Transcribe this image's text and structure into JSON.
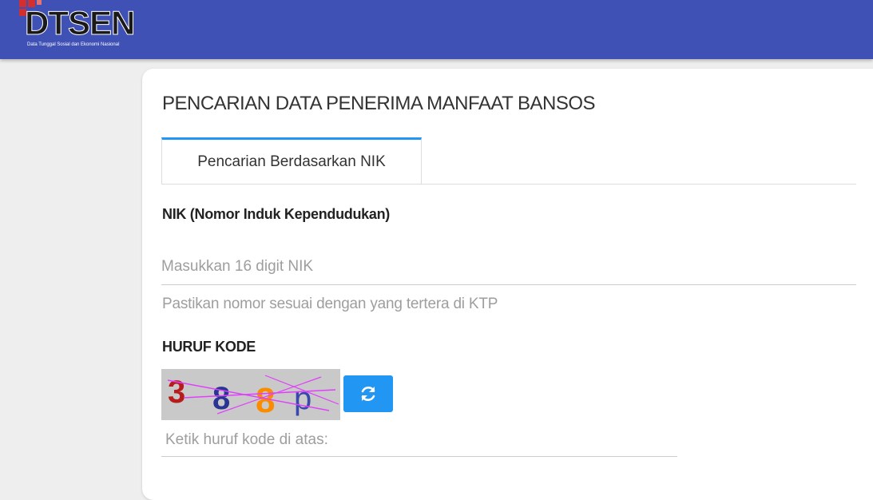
{
  "header": {
    "logo_text": "DTSEN",
    "logo_tagline": "Data Tunggal Sosial dan Ekonomi Nasional",
    "color": "#3f51b5"
  },
  "form": {
    "title": "PENCARIAN DATA PENERIMA MANFAAT BANSOS",
    "tab_label": "Pencarian Berdasarkan NIK",
    "nik_label": "NIK (Nomor Induk Kependudukan)",
    "nik_placeholder": "Masukkan 16 digit NIK",
    "nik_help": "Pastikan nomor sesuai dengan yang tertera di KTP",
    "kode_label": "HURUF KODE",
    "captcha_chars": [
      "3",
      "8",
      "8",
      "p"
    ],
    "captcha_colors": [
      "#b71c1c",
      "#283593",
      "#fb8c00",
      "#3949ab"
    ],
    "refresh_icon": "refresh-icon",
    "kode_placeholder": "Ketik huruf kode di atas:",
    "accent": "#2196f3"
  }
}
